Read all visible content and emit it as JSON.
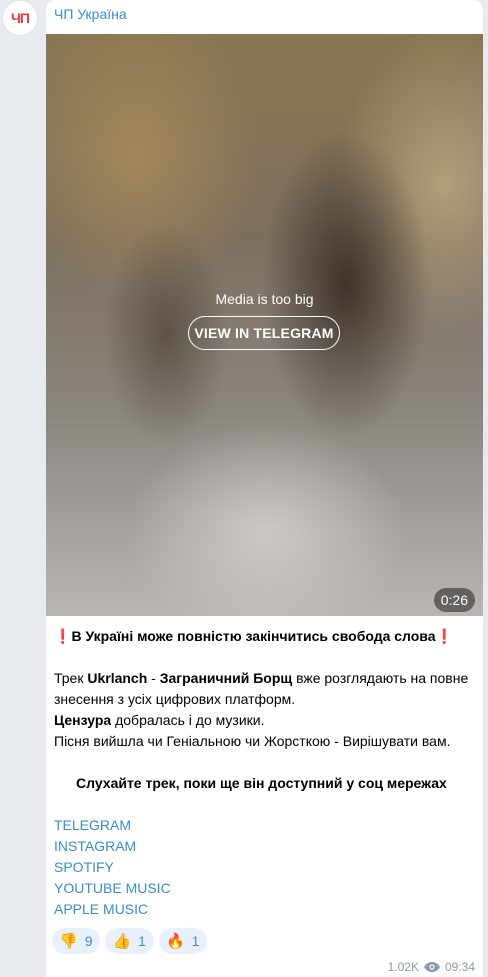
{
  "channel": {
    "avatar_text": "ЧП",
    "name": "ЧП Україна"
  },
  "media": {
    "note": "Media is too big",
    "button_label": "VIEW IN TELEGRAM",
    "duration": "0:26"
  },
  "post": {
    "headline_icon_left": "❗",
    "headline": "В Україні може повністю закінчитись свобода слова",
    "headline_icon_right": "❗",
    "p1_prefix": "Трек ",
    "p1_artist": "Ukrlanch",
    "p1_dash": " - ",
    "p1_title": "Заграничний Борщ",
    "p1_suffix": " вже розглядають на повне знесення з усіх цифрових платформ.",
    "p2_bold": "Цензура",
    "p2_rest": " добралась і до музики.",
    "p3": "Пісня вийшла чи Геніальною чи Жорсткою - Вирішувати вам.",
    "p4": "Слухайте трек, поки ще він доступний у соц мережах",
    "links": [
      "TELEGRAM",
      "INSTAGRAM",
      "SPOTIFY",
      "YOUTUBE MUSIC",
      "APPLE MUSIC"
    ]
  },
  "reactions": [
    {
      "emoji": "👎",
      "count": "9"
    },
    {
      "emoji": "👍",
      "count": "1"
    },
    {
      "emoji": "🔥",
      "count": "1"
    }
  ],
  "meta": {
    "views": "1.02K",
    "time": "09:34",
    "view_icon": "eye-icon"
  },
  "colors": {
    "accent": "#3a8dcc",
    "warning": "#e53935",
    "background": "#e7ebf0"
  }
}
